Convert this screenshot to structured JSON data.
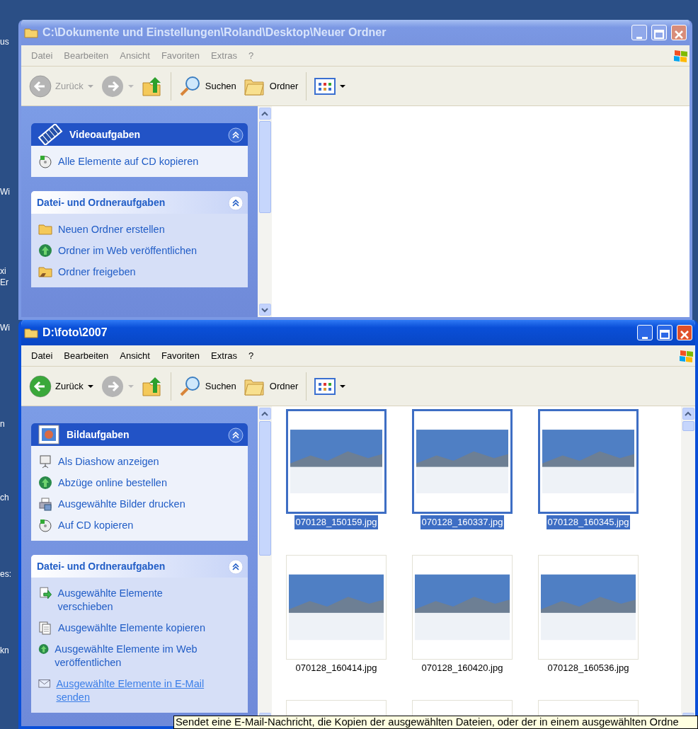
{
  "desktop_labels": [
    "us",
    "Wi",
    "xi",
    "Er",
    "Wi",
    "n",
    "ch",
    "es:",
    "kn"
  ],
  "windows": [
    {
      "title": "C:\\Dokumente und Einstellungen\\Roland\\Desktop\\Neuer Ordner",
      "active": false,
      "menu": [
        "Datei",
        "Bearbeiten",
        "Ansicht",
        "Favoriten",
        "Extras",
        "?"
      ],
      "toolbar": {
        "back_label": "Zurück",
        "back_enabled": false,
        "search_label": "Suchen",
        "folders_label": "Ordner"
      },
      "task_panels": [
        {
          "title": "Videoaufgaben",
          "kind": "special",
          "items": [
            {
              "label": "Alle Elemente auf CD kopieren",
              "hover": false
            }
          ]
        },
        {
          "title": "Datei- und Ordneraufgaben",
          "kind": "plain",
          "items": [
            {
              "label": "Neuen Ordner erstellen",
              "hover": false
            },
            {
              "label": "Ordner im Web veröffentlichen",
              "hover": false
            },
            {
              "label": "Ordner freigeben",
              "hover": false
            }
          ]
        }
      ]
    },
    {
      "title": "D:\\foto\\2007",
      "active": true,
      "menu": [
        "Datei",
        "Bearbeiten",
        "Ansicht",
        "Favoriten",
        "Extras",
        "?"
      ],
      "toolbar": {
        "back_label": "Zurück",
        "back_enabled": true,
        "search_label": "Suchen",
        "folders_label": "Ordner"
      },
      "task_panels": [
        {
          "title": "Bildaufgaben",
          "kind": "special",
          "items": [
            {
              "label": "Als Diashow anzeigen",
              "hover": false
            },
            {
              "label": "Abzüge online bestellen",
              "hover": false
            },
            {
              "label": "Ausgewählte Bilder drucken",
              "hover": false
            },
            {
              "label": "Auf CD kopieren",
              "hover": false
            }
          ]
        },
        {
          "title": "Datei- und Ordneraufgaben",
          "kind": "plain",
          "items": [
            {
              "label": "Ausgewählte Elemente verschieben",
              "hover": false
            },
            {
              "label": "Ausgewählte Elemente kopieren",
              "hover": false
            },
            {
              "label": "Ausgewählte Elemente im Web veröffentlichen",
              "hover": false
            },
            {
              "label": "Ausgewählte Elemente in E-Mail senden",
              "hover": true
            }
          ]
        }
      ],
      "files": [
        {
          "name": "070128_150159.jpg",
          "selected": true
        },
        {
          "name": "070128_160337.jpg",
          "selected": true
        },
        {
          "name": "070128_160345.jpg",
          "selected": true
        },
        {
          "name": "070128_160414.jpg",
          "selected": false
        },
        {
          "name": "070128_160420.jpg",
          "selected": false
        },
        {
          "name": "070128_160536.jpg",
          "selected": false
        },
        {
          "selected": false
        },
        {
          "selected": false
        },
        {
          "selected": false
        }
      ]
    }
  ],
  "tooltip": "Sendet eine E-Mail-Nachricht, die Kopien der ausgewählten Dateien, oder der in einem ausgewählten Ordne"
}
